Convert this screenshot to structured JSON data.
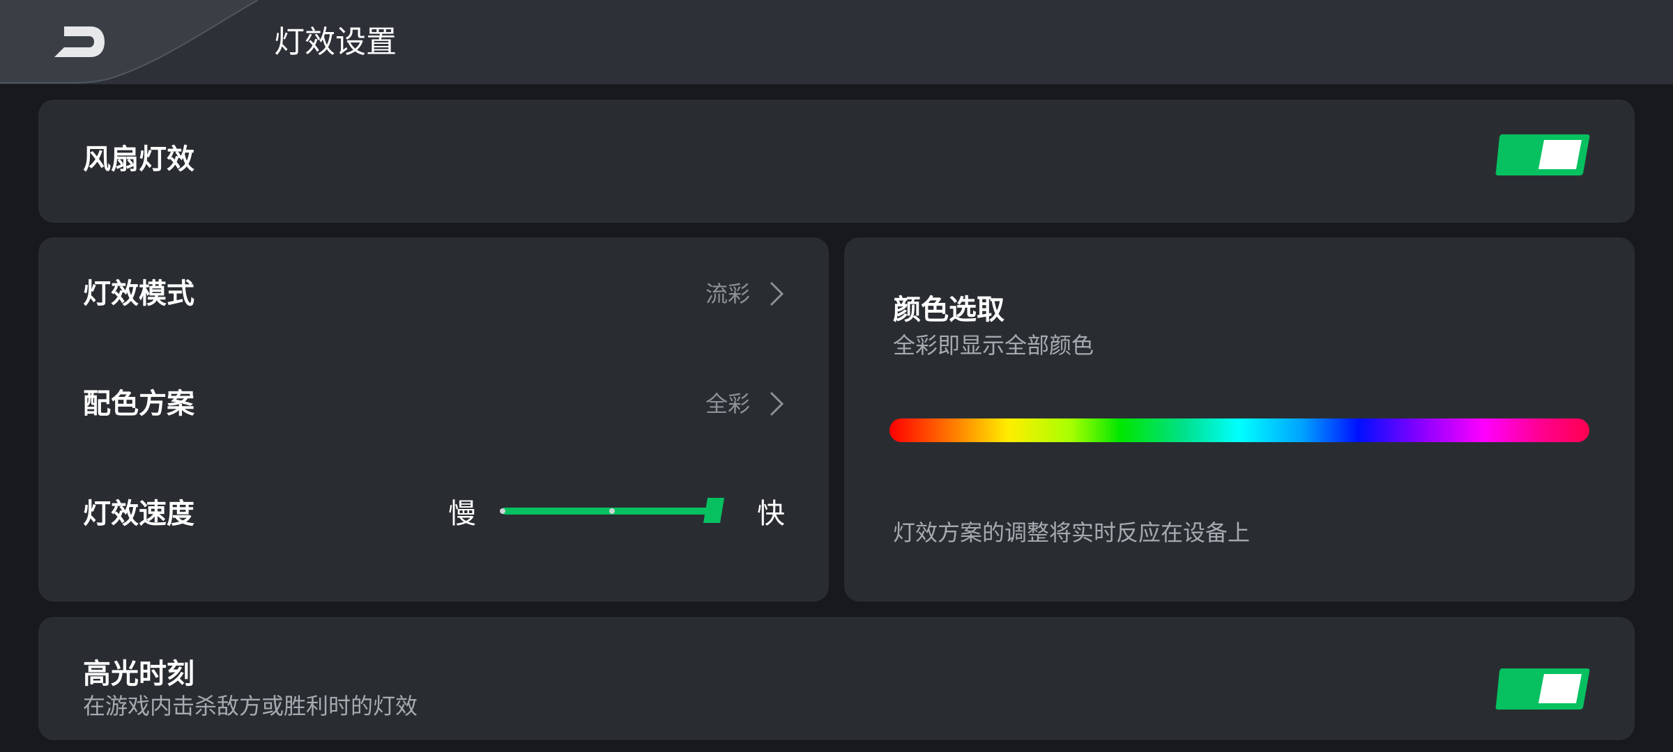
{
  "header": {
    "title": "灯效设置",
    "back_icon": "back-arrow-icon"
  },
  "fan_light": {
    "label": "风扇灯效",
    "toggle_on": true
  },
  "settings": {
    "mode": {
      "label": "灯效模式",
      "value": "流彩"
    },
    "scheme": {
      "label": "配色方案",
      "value": "全彩"
    },
    "speed": {
      "label": "灯效速度",
      "min_label": "慢",
      "max_label": "快",
      "level": 1.0,
      "steps": 3
    }
  },
  "color_pick": {
    "title": "颜色选取",
    "subtitle": "全彩即显示全部颜色",
    "note": "灯效方案的调整将实时反应在设备上"
  },
  "highlight": {
    "label": "高光时刻",
    "subtitle": "在游戏内击杀敌方或胜利时的灯效",
    "toggle_on": true
  },
  "colors": {
    "accent": "#07c160",
    "card": "#292d32",
    "background": "#17191c",
    "header": "#2d3137"
  }
}
